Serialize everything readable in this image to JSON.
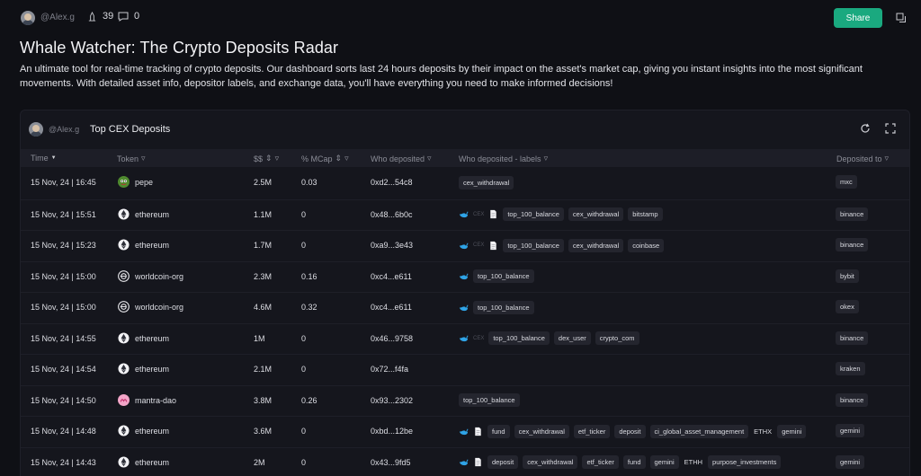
{
  "topbar": {
    "username": "@Alex.g",
    "likes": "39",
    "comments": "0",
    "share_label": "Share"
  },
  "page": {
    "title": "Whale Watcher: The Crypto Deposits Radar",
    "description": "An ultimate tool for real-time tracking of crypto deposits. Our dashboard sorts last 24 hours deposits by their impact on the asset's market cap, giving you instant insights into the most significant movements. With detailed asset info, depositor labels, and exchange data, you'll have everything you need to make informed decisions!"
  },
  "widget": {
    "username": "@Alex.g",
    "title": "Top CEX Deposits"
  },
  "table": {
    "columns": [
      "Time",
      "Token",
      "$$",
      "% MCap",
      "Who deposited",
      "Who deposited - labels",
      "Deposited to"
    ],
    "rows": [
      {
        "time": "15 Nov, 24 | 16:45",
        "token": "pepe",
        "icon": "pepe",
        "usd": "2.5M",
        "mcap": "0.03",
        "who": "0xd2...54c8",
        "whale": false,
        "cex": false,
        "doc": false,
        "labels": [
          "cex_withdrawal"
        ],
        "to": "mxc"
      },
      {
        "time": "15 Nov, 24 | 15:51",
        "token": "ethereum",
        "icon": "ethereum",
        "usd": "1.1M",
        "mcap": "0",
        "who": "0x48...6b0c",
        "whale": true,
        "cex": true,
        "doc": true,
        "labels": [
          "top_100_balance",
          "cex_withdrawal",
          "bitstamp"
        ],
        "to": "binance"
      },
      {
        "time": "15 Nov, 24 | 15:23",
        "token": "ethereum",
        "icon": "ethereum",
        "usd": "1.7M",
        "mcap": "0",
        "who": "0xa9...3e43",
        "whale": true,
        "cex": true,
        "doc": true,
        "labels": [
          "top_100_balance",
          "cex_withdrawal",
          "coinbase"
        ],
        "to": "binance"
      },
      {
        "time": "15 Nov, 24 | 15:00",
        "token": "worldcoin-org",
        "icon": "worldcoin",
        "usd": "2.3M",
        "mcap": "0.16",
        "who": "0xc4...e611",
        "whale": true,
        "cex": false,
        "doc": false,
        "labels": [
          "top_100_balance"
        ],
        "to": "bybit"
      },
      {
        "time": "15 Nov, 24 | 15:00",
        "token": "worldcoin-org",
        "icon": "worldcoin",
        "usd": "4.6M",
        "mcap": "0.32",
        "who": "0xc4...e611",
        "whale": true,
        "cex": false,
        "doc": false,
        "labels": [
          "top_100_balance"
        ],
        "to": "okex"
      },
      {
        "time": "15 Nov, 24 | 14:55",
        "token": "ethereum",
        "icon": "ethereum",
        "usd": "1M",
        "mcap": "0",
        "who": "0x46...9758",
        "whale": true,
        "cex": true,
        "doc": false,
        "labels": [
          "top_100_balance",
          "dex_user",
          "crypto_com"
        ],
        "to": "binance"
      },
      {
        "time": "15 Nov, 24 | 14:54",
        "token": "ethereum",
        "icon": "ethereum",
        "usd": "2.1M",
        "mcap": "0",
        "who": "0x72...f4fa",
        "whale": false,
        "cex": false,
        "doc": false,
        "labels": [],
        "to": "kraken"
      },
      {
        "time": "15 Nov, 24 | 14:50",
        "token": "mantra-dao",
        "icon": "mantra",
        "usd": "3.8M",
        "mcap": "0.26",
        "who": "0x93...2302",
        "whale": false,
        "cex": false,
        "doc": false,
        "labels": [
          "top_100_balance"
        ],
        "to": "binance"
      },
      {
        "time": "15 Nov, 24 | 14:48",
        "token": "ethereum",
        "icon": "ethereum",
        "usd": "3.6M",
        "mcap": "0",
        "who": "0xbd...12be",
        "whale": true,
        "cex": false,
        "doc": true,
        "labels": [
          "fund",
          "cex_withdrawal",
          "etf_ticker",
          "deposit",
          "ci_global_asset_management",
          "ETHX",
          "gemini"
        ],
        "to": "gemini"
      },
      {
        "time": "15 Nov, 24 | 14:43",
        "token": "ethereum",
        "icon": "ethereum",
        "usd": "2M",
        "mcap": "0",
        "who": "0x43...9fd5",
        "whale": true,
        "cex": false,
        "doc": true,
        "labels": [
          "deposit",
          "cex_withdrawal",
          "etf_ticker",
          "fund",
          "gemini",
          "ETHH",
          "purpose_investments"
        ],
        "to": "gemini"
      }
    ]
  },
  "colors": {
    "accent": "#1aa97f",
    "background": "#0f1015",
    "panel": "#15161d",
    "tag": "#24252e",
    "whale": "#2fa4e7"
  },
  "icons": [
    "user-avatar",
    "tip-icon",
    "comment-icon",
    "copy-icon",
    "refresh-icon",
    "expand-icon",
    "filter-icon",
    "sort-desc-icon",
    "whale-icon",
    "document-icon"
  ]
}
